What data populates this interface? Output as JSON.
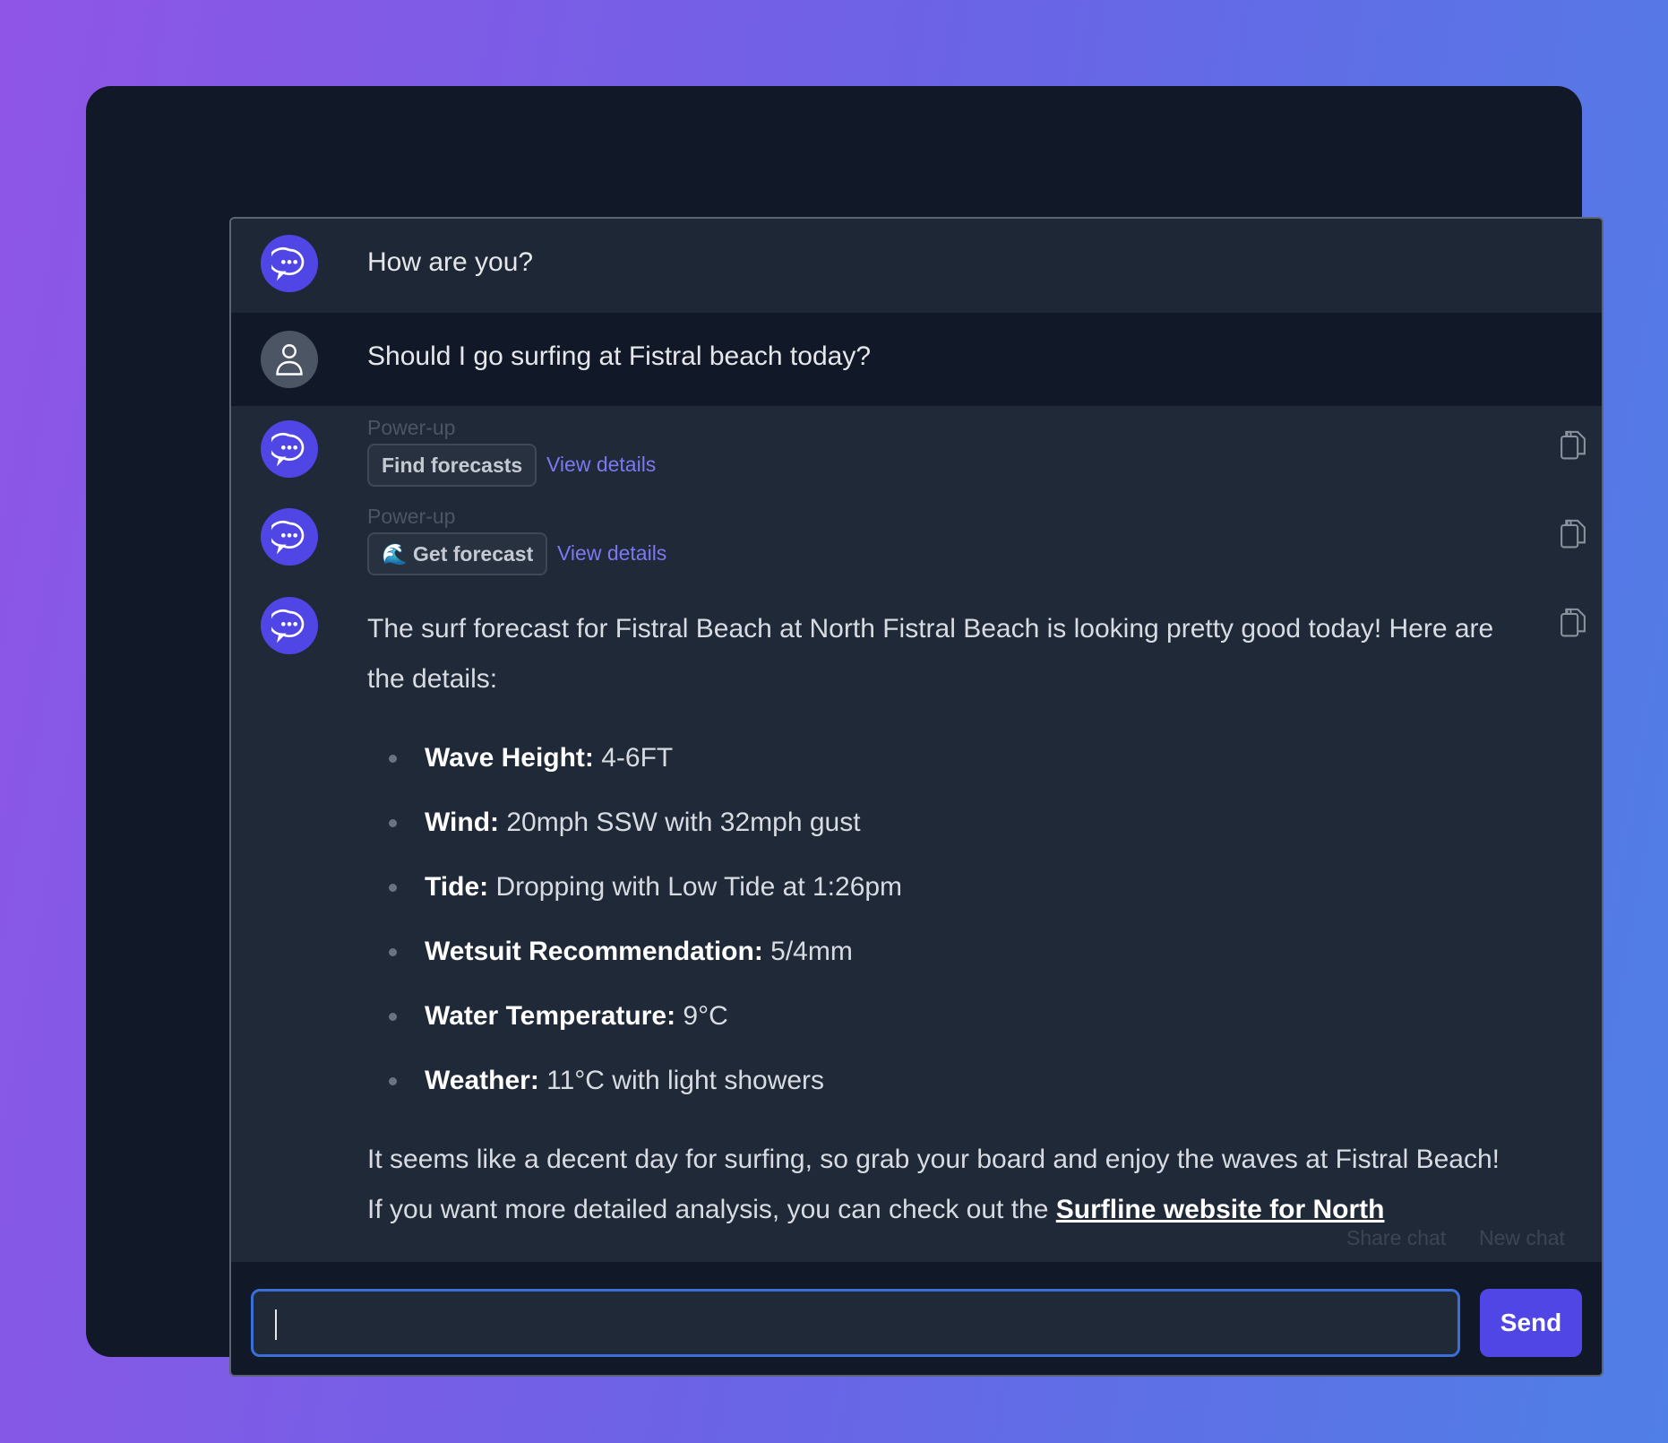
{
  "messages": [
    {
      "role": "assistant",
      "text": "How are you?"
    },
    {
      "role": "user",
      "text": "Should I go surfing at Fistral beach today?"
    },
    {
      "role": "assistant",
      "powerup_label": "Power-up",
      "chip": "Find forecasts",
      "link": "View details"
    },
    {
      "role": "assistant",
      "powerup_label": "Power-up",
      "chip": "🌊 Get forecast",
      "link": "View details"
    }
  ],
  "answer": {
    "intro": "The surf forecast for Fistral Beach at North Fistral Beach is looking pretty good today! Here are the details:",
    "items": [
      {
        "label": "Wave Height:",
        "value": " 4-6FT"
      },
      {
        "label": "Wind:",
        "value": " 20mph SSW with 32mph gust"
      },
      {
        "label": "Tide:",
        "value": " Dropping with Low Tide at 1:26pm"
      },
      {
        "label": "Wetsuit Recommendation:",
        "value": " 5/4mm"
      },
      {
        "label": "Water Temperature:",
        "value": " 9°C"
      },
      {
        "label": "Weather:",
        "value": " 11°C with light showers"
      }
    ],
    "outro": "It seems like a decent day for surfing, so grab your board and enjoy the waves at Fistral Beach! If you want more detailed analysis, you can check out the ",
    "link": "Surfline website for North"
  },
  "ghost": {
    "share": "Share chat",
    "new": "New chat"
  },
  "composer": {
    "value": "",
    "send_label": "Send"
  },
  "colors": {
    "accent": "#4f46e5",
    "link": "#7c78f0"
  }
}
